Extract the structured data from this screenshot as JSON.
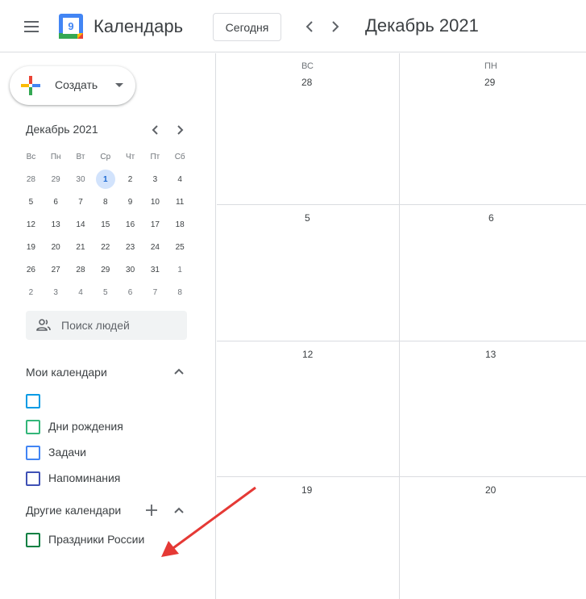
{
  "header": {
    "app_title": "Календарь",
    "logo_day": "9",
    "today_label": "Сегодня",
    "period_title": "Декабрь 2021"
  },
  "sidebar": {
    "create_label": "Создать",
    "mini_calendar": {
      "title": "Декабрь 2021",
      "weekdays": [
        "Вс",
        "Пн",
        "Вт",
        "Ср",
        "Чт",
        "Пт",
        "Сб"
      ],
      "weeks": [
        [
          "28",
          "29",
          "30",
          "1",
          "2",
          "3",
          "4"
        ],
        [
          "5",
          "6",
          "7",
          "8",
          "9",
          "10",
          "11"
        ],
        [
          "12",
          "13",
          "14",
          "15",
          "16",
          "17",
          "18"
        ],
        [
          "19",
          "20",
          "21",
          "22",
          "23",
          "24",
          "25"
        ],
        [
          "26",
          "27",
          "28",
          "29",
          "30",
          "31",
          "1"
        ],
        [
          "2",
          "3",
          "4",
          "5",
          "6",
          "7",
          "8"
        ]
      ],
      "today": "1"
    },
    "people_search_placeholder": "Поиск людей",
    "my_calendars": {
      "title": "Мои календари",
      "items": [
        {
          "label": "",
          "color": "#039be5"
        },
        {
          "label": "Дни рождения",
          "color": "#33b679"
        },
        {
          "label": "Задачи",
          "color": "#4285f4"
        },
        {
          "label": "Напоминания",
          "color": "#3f51b5"
        }
      ]
    },
    "other_calendars": {
      "title": "Другие календари",
      "items": [
        {
          "label": "Праздники России",
          "color": "#0b8043"
        }
      ]
    }
  },
  "grid": {
    "columns": [
      {
        "dow": "ВС",
        "dates": [
          "28",
          "5",
          "12",
          "19"
        ]
      },
      {
        "dow": "ПН",
        "dates": [
          "29",
          "6",
          "13",
          "20"
        ]
      }
    ]
  },
  "colors": {
    "accent": "#1a73e8",
    "today_bg": "#d2e3fc",
    "arrow": "#e53935",
    "border": "#dadce0"
  }
}
